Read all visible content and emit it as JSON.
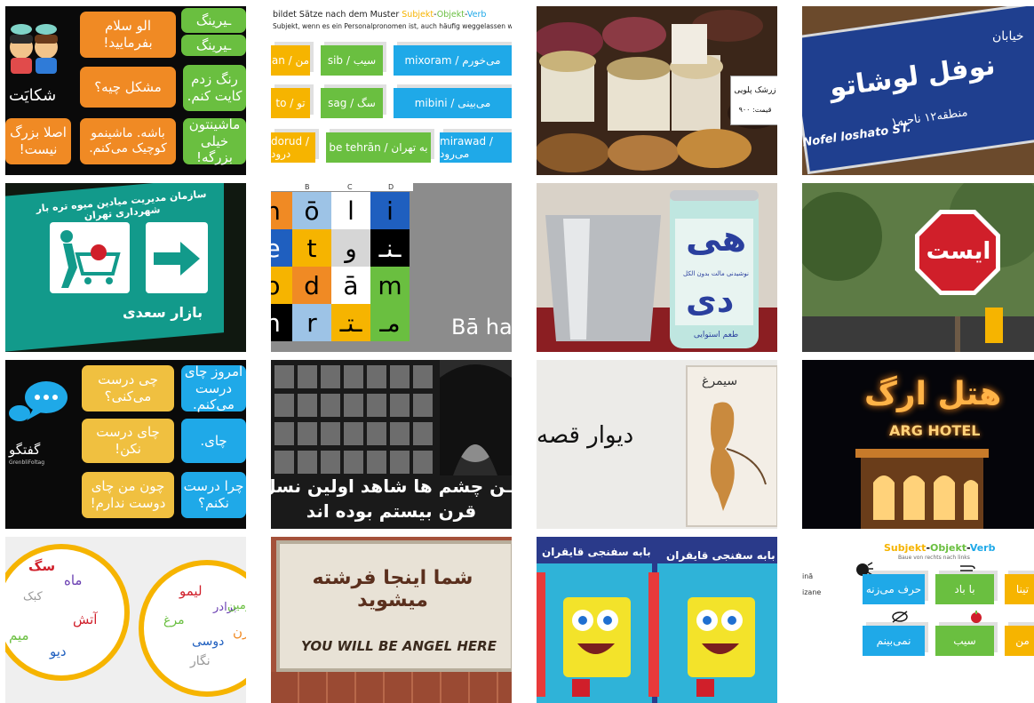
{
  "tiles": {
    "t1": {
      "green_a": "ـیرینگ",
      "green_b": "ـیرینگ",
      "orange_a": "الو سلام\nبفرمایید!",
      "green_c": "رنگ زدم\nکایت کنم.",
      "orange_b": "مشکل چیه؟",
      "bottom_left": "شکایَت",
      "orange_c": "اصلا بزرگ\nنیست!",
      "orange_d": "باشه. ماشینمو\nکوچیک می‌کنم.",
      "green_d": "ماشینتون\nخیلی بزرگه!"
    },
    "t2": {
      "header": "bildet Sätze nach dem Muster ",
      "header_subjekt": "Subjekt",
      "header_objekt": "Objekt",
      "header_verb": "Verb",
      "subheader": "Subjekt, wenn es ein Personalpronomen ist, auch häufig weggelassen wird (z.B. می‌آیم).",
      "r1_subj": "an / من",
      "r1_obj": "sib / سیب",
      "r1_verb": "mixoram / می‌خورم",
      "r2_subj": "to / تو",
      "r2_obj": "sag / سگ",
      "r2_verb": "mibini / می‌بینی",
      "r3_subj": "dorud / درود",
      "r3_obj": "be tehrān / به تهران",
      "r3_verb": "mirawad / می‌رود"
    },
    "t3": {
      "label": "زرشک پلویی",
      "price": "قیمت: ۹۰۰"
    },
    "t4": {
      "top": "خیابان",
      "name": "نوفل لوشاتو",
      "district": "منطقه۱۲ ناحیه۱",
      "latin": "Nofel loshato ST."
    },
    "t5": {
      "org": "سازمان مدیریت میادین میوه تره بار شهرداری تهران",
      "bazaar": "بازار سعدی"
    },
    "t6": {
      "col_b": "B",
      "col_c": "C",
      "col_d": "D",
      "cells": [
        "n",
        "ō",
        "ا",
        "i",
        "e",
        "t",
        "و",
        "ـنـ",
        "o",
        "d",
        "ā",
        "m",
        "h",
        "r",
        "ـتـ",
        "مـ"
      ],
      "caption": "Bā ha"
    },
    "t7": {
      "brand_a": "هی",
      "brand_b": "دی",
      "tagline": "نوشیدنی مالت بدون الکل",
      "flavor": "طعم استوایی"
    },
    "t8": {
      "stop": "ایست"
    },
    "t9": {
      "logo_text": "گفتگو",
      "logo_sub": "GrenbliFoltag",
      "y1": "چی درست\nمی‌کنی؟",
      "b1": "امروز چای\nدرست می‌کنم.",
      "y2": "چای درست\nنکن!",
      "b2": "چای.",
      "y3": "چون من چای\nدوست ندارم!",
      "b3": "چرا درست\nنکنم؟"
    },
    "t10": {
      "line1": "ـن چشم ها شاهد اولین نسل کشی",
      "line2": "قرن بیستم بوده اند"
    },
    "t11": {
      "wall": "دیوار قصه",
      "poster_title": "سیمرغ"
    },
    "t12": {
      "hotel_fa": "هتل ارگ",
      "hotel_en": "ARG HOTEL"
    },
    "t13": {
      "w_left": [
        "سگ",
        "ماه",
        "کبک",
        "آتش",
        "میم",
        "دیو"
      ],
      "w_right": [
        "لیمو",
        "برادر",
        "مرغ",
        "زن",
        "دوسی",
        "نگار",
        "زمین"
      ]
    },
    "t14": {
      "fa": "شما اینجا فرشته میشوید",
      "en": "YOU WILL BE ANGEL HERE"
    },
    "t15": {
      "banner": "بابه سفنجی قایقران"
    },
    "t16": {
      "title_subjekt": "Subjekt",
      "title_objekt": "Objekt",
      "title_verb": "Verb",
      "subtitle": "Baue von rechts nach links",
      "left_a": "inā",
      "left_b": "izane",
      "c1": "حرف می‌زنه",
      "c2": "با باد",
      "c3": "تینا",
      "c4": "نمی‌بینم",
      "c5": "سیب",
      "c6": "من"
    }
  },
  "colors": {
    "green": "#6abf40",
    "orange": "#f08a24",
    "blue": "#1fa9e8",
    "yellow": "#f6b400",
    "teal": "#12a08e",
    "red": "#d01f2a"
  }
}
